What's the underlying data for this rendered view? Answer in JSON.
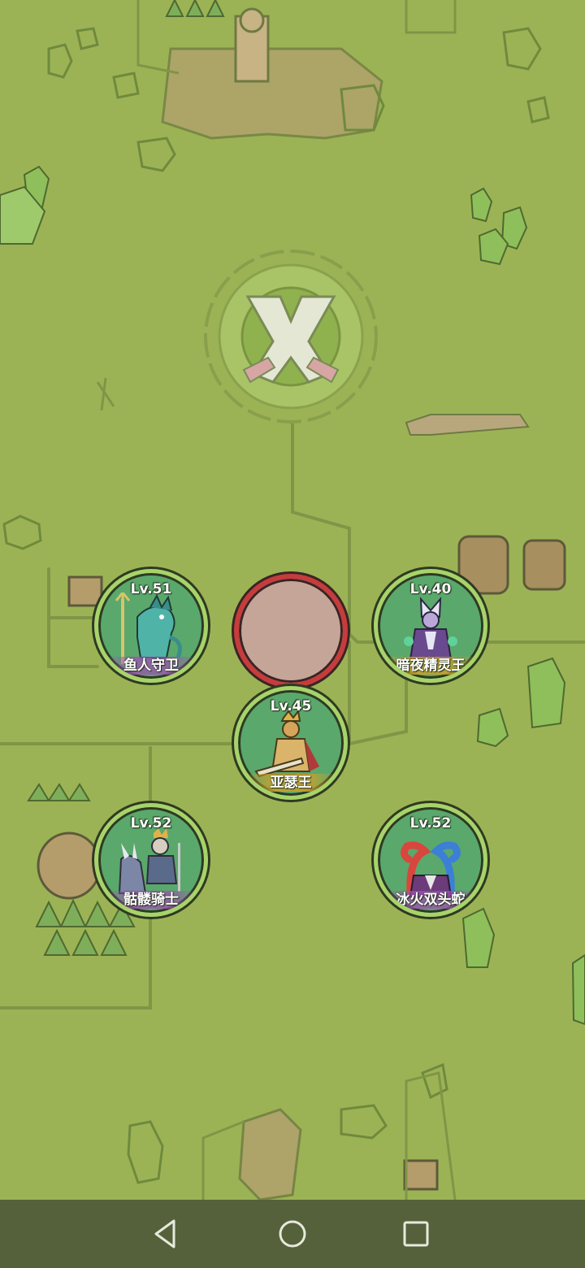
{
  "bosses": [
    {
      "level": "Lv.51",
      "name": "鱼人守卫",
      "art": "fishman-guard"
    },
    {
      "level": "Lv.40",
      "name": "暗夜精灵王",
      "art": "night-elf-king"
    },
    {
      "level": "Lv.45",
      "name": "亚瑟王",
      "art": "king-arthur"
    },
    {
      "level": "Lv.52",
      "name": "骷髅骑士",
      "art": "skeleton-knight"
    },
    {
      "level": "Lv.52",
      "name": "冰火双头蛇",
      "art": "ice-fire-hydra"
    }
  ],
  "center_emblem": "crossed-swords-icon",
  "navbar": {
    "back": "back-triangle-icon",
    "home": "home-circle-icon",
    "recents": "recents-square-icon"
  },
  "colors": {
    "background": "#9cb355",
    "boss_ring": "#a7d36a",
    "boss_fill": "#5aa86c",
    "empty_ring": "#c63c3c",
    "navbar": "#55613a"
  }
}
